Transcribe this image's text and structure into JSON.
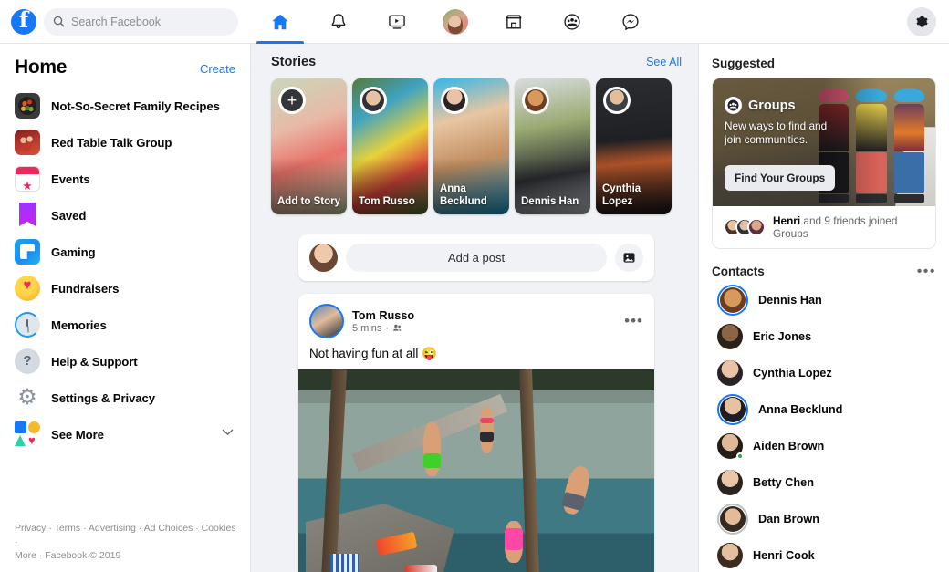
{
  "topbar": {
    "logo": "facebook-logo",
    "search": {
      "placeholder": "Search Facebook",
      "value": "",
      "icon": "search-icon"
    },
    "nav": [
      {
        "name": "home",
        "icon": "home-icon",
        "active": true
      },
      {
        "name": "notifications",
        "icon": "bell-icon",
        "active": false
      },
      {
        "name": "watch",
        "icon": "video-icon",
        "active": false
      },
      {
        "name": "profile",
        "icon": "avatar-icon",
        "active": false
      },
      {
        "name": "marketplace",
        "icon": "store-icon",
        "active": false
      },
      {
        "name": "groups",
        "icon": "groups-icon",
        "active": false
      },
      {
        "name": "messenger",
        "icon": "messenger-icon",
        "active": false
      }
    ],
    "settings_icon": "gear-icon"
  },
  "sidebar": {
    "title": "Home",
    "create_label": "Create",
    "items": [
      {
        "label": "Not-So-Secret Family Recipes",
        "icon": "group-photo-icon"
      },
      {
        "label": "Red Table Talk Group",
        "icon": "group-photo-icon"
      },
      {
        "label": "Events",
        "icon": "calendar-icon"
      },
      {
        "label": "Saved",
        "icon": "bookmark-icon"
      },
      {
        "label": "Gaming",
        "icon": "gaming-icon"
      },
      {
        "label": "Fundraisers",
        "icon": "heart-icon"
      },
      {
        "label": "Memories",
        "icon": "clock-icon"
      },
      {
        "label": "Help & Support",
        "icon": "question-icon"
      },
      {
        "label": "Settings & Privacy",
        "icon": "gear-icon"
      },
      {
        "label": "See More",
        "icon": "shapes-icon",
        "chevron": "chevron-down-icon"
      }
    ],
    "footer": {
      "line1": "Privacy · Terms · Advertising · Ad Choices · Cookies ·",
      "line2": "More · Facebook © 2019"
    }
  },
  "feed": {
    "stories": {
      "title": "Stories",
      "see_all": "See All",
      "items": [
        {
          "name": "Add to Story",
          "type": "add",
          "icon": "plus-icon"
        },
        {
          "name": "Tom Russo",
          "type": "story"
        },
        {
          "name": "Anna Becklund",
          "type": "story"
        },
        {
          "name": "Dennis Han",
          "type": "story"
        },
        {
          "name": "Cynthia Lopez",
          "type": "story"
        }
      ]
    },
    "composer": {
      "placeholder": "Add a post",
      "photo_icon": "photo-icon",
      "avatar": "user-avatar"
    },
    "post": {
      "author": "Tom Russo",
      "time": "5 mins",
      "separator": "·",
      "audience_icon": "friends-icon",
      "menu_icon": "more-options-icon",
      "text": "Not having fun at all 😜",
      "image_alt": "people jumping off a dock into a lake"
    }
  },
  "rail": {
    "suggested": {
      "title": "Suggested",
      "card": {
        "brand": "Groups",
        "brand_icon": "groups-icon",
        "subtitle": "New ways to find and join communities.",
        "button": "Find Your Groups",
        "footer_name": "Henri",
        "footer_rest": " and 9 friends joined Groups"
      }
    },
    "contacts": {
      "title": "Contacts",
      "menu_icon": "more-options-icon",
      "items": [
        {
          "name": "Dennis Han",
          "ring": "blue",
          "online": false
        },
        {
          "name": "Eric Jones",
          "ring": "none",
          "online": false
        },
        {
          "name": "Cynthia Lopez",
          "ring": "none",
          "online": false
        },
        {
          "name": "Anna Becklund",
          "ring": "blue",
          "online": false
        },
        {
          "name": "Aiden Brown",
          "ring": "none",
          "online": true
        },
        {
          "name": "Betty Chen",
          "ring": "none",
          "online": false
        },
        {
          "name": "Dan Brown",
          "ring": "gray",
          "online": false
        },
        {
          "name": "Henri Cook",
          "ring": "none",
          "online": false
        }
      ]
    }
  },
  "colors": {
    "brand_blue": "#1877f2",
    "page_bg": "#f0f2f5",
    "card_bg": "#ffffff",
    "text": "#050505",
    "muted": "#65676b",
    "online_green": "#31a24c"
  }
}
